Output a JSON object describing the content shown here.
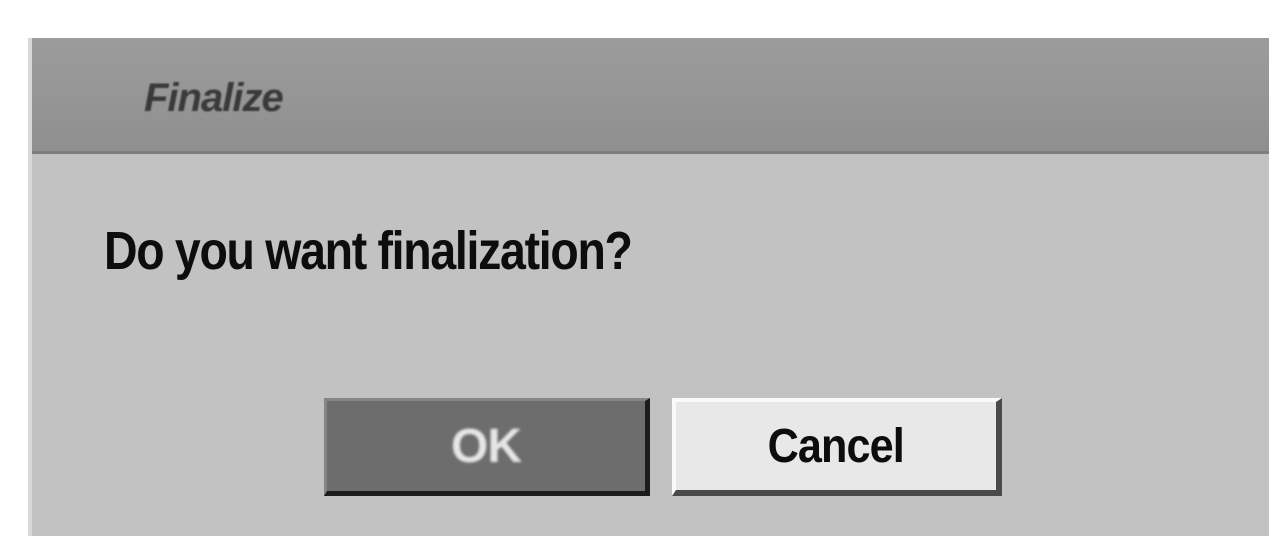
{
  "dialog": {
    "title": "Finalize",
    "message": "Do you want finalization?",
    "buttons": {
      "ok_label": "OK",
      "cancel_label": "Cancel"
    },
    "selected_button": "OK"
  }
}
